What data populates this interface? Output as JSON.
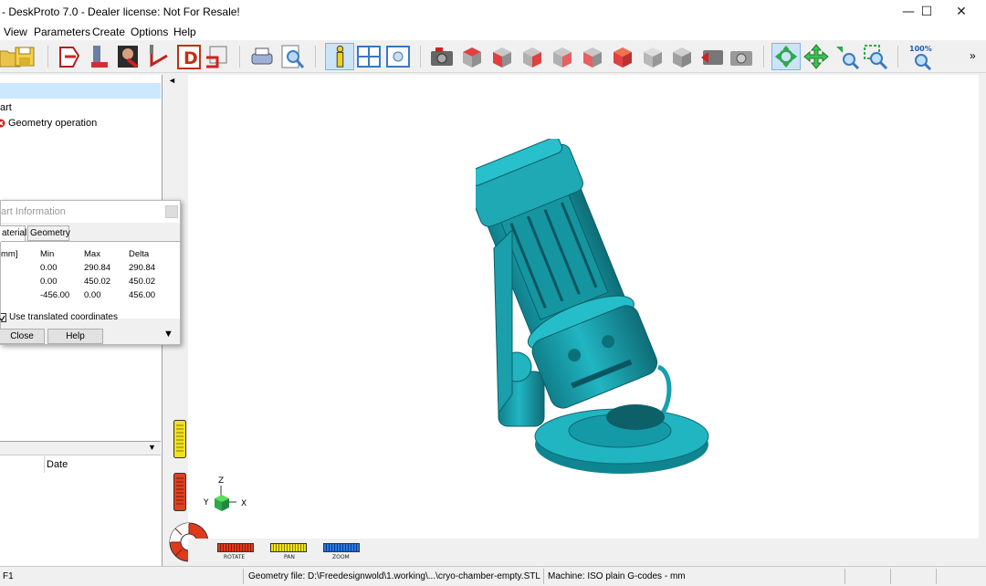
{
  "window": {
    "title": "- DeskProto 7.0 - Dealer license: Not For Resale!",
    "minimize_glyph": "—",
    "maximize_glyph": "☐",
    "close_glyph": "✕"
  },
  "menu": [
    "View",
    "Parameters",
    "Create",
    "Options",
    "Help"
  ],
  "toolbar": {
    "zoom_100_label": "100%",
    "overflow_glyph": "»",
    "icons": [
      "open-folder-icon",
      "save-icon",
      "part-wizard-icon",
      "machining-icon",
      "person-icon",
      "toolpath-icon",
      "d-icon",
      "save-toolpath-icon",
      "print-icon",
      "print-preview-icon",
      "info-icon",
      "view-layout-icon",
      "details-icon",
      "camera-icon",
      "view-top-icon",
      "view-front-icon",
      "view-right-icon",
      "view-back-icon",
      "view-left-icon",
      "view-bottom-icon",
      "view-iso-icon",
      "view-iso2-icon",
      "reset-view-icon",
      "photo-icon",
      "rotate-icon",
      "pan-icon",
      "zoom-icon",
      "zoom-window-icon",
      "zoom-100-icon"
    ]
  },
  "tree": {
    "items": [
      "art",
      "Geometry operation"
    ]
  },
  "list": {
    "columns": [
      "Date"
    ],
    "dropdown_glyph": "▼"
  },
  "dialog": {
    "title": "art Information",
    "tabs": [
      "aterial",
      "Geometry"
    ],
    "columns": [
      "mm]",
      "Min",
      "Max",
      "Delta"
    ],
    "rows": [
      {
        "min": "0.00",
        "max": "290.84",
        "delta": "290.84"
      },
      {
        "min": "0.00",
        "max": "450.02",
        "delta": "450.02"
      },
      {
        "min": "-456.00",
        "max": "0.00",
        "delta": "456.00"
      }
    ],
    "checkbox_label": "Use translated coordinates",
    "checkbox_checked": true,
    "close_label": "Close",
    "help_label": "Help",
    "more_glyph": "▼"
  },
  "viewport": {
    "collapse_glyph": "◄",
    "axes": {
      "z": "Z",
      "y": "Y",
      "x": "X"
    },
    "controls": {
      "rotate": "ROTATE",
      "pan": "PAN",
      "zoom": "ZOOM"
    },
    "model_color": "#21b5c2"
  },
  "status": {
    "help": "F1",
    "geometry_file": "Geometry file: D:\\Freedesignwold\\1.working\\...\\cryo-chamber-empty.STL",
    "machine": "Machine: ISO plain G-codes - mm"
  }
}
